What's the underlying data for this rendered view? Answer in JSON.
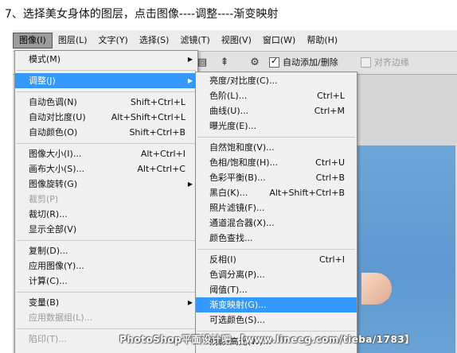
{
  "caption": "7、选择美女身体的图层，点击图像----调整----渐变映射",
  "menubar": [
    "图像(I)",
    "图层(L)",
    "文字(Y)",
    "选择(S)",
    "滤镜(T)",
    "视图(V)",
    "窗口(W)",
    "帮助(H)"
  ],
  "options_bar": {
    "auto_add_delete": "自动添加/删除",
    "align_edges": "对齐边缘"
  },
  "image_menu": [
    {
      "label": "模式(M)",
      "submenu": true
    },
    {
      "sep": true
    },
    {
      "label": "调整(J)",
      "submenu": true,
      "highlight": true
    },
    {
      "sep": true
    },
    {
      "label": "自动色调(N)",
      "shortcut": "Shift+Ctrl+L"
    },
    {
      "label": "自动对比度(U)",
      "shortcut": "Alt+Shift+Ctrl+L"
    },
    {
      "label": "自动颜色(O)",
      "shortcut": "Shift+Ctrl+B"
    },
    {
      "sep": true
    },
    {
      "label": "图像大小(I)...",
      "shortcut": "Alt+Ctrl+I"
    },
    {
      "label": "画布大小(S)...",
      "shortcut": "Alt+Ctrl+C"
    },
    {
      "label": "图像旋转(G)",
      "submenu": true
    },
    {
      "label": "裁剪(P)",
      "disabled": true
    },
    {
      "label": "裁切(R)..."
    },
    {
      "label": "显示全部(V)"
    },
    {
      "sep": true
    },
    {
      "label": "复制(D)..."
    },
    {
      "label": "应用图像(Y)..."
    },
    {
      "label": "计算(C)..."
    },
    {
      "sep": true
    },
    {
      "label": "变量(B)",
      "submenu": true
    },
    {
      "label": "应用数据组(L)...",
      "disabled": true
    },
    {
      "sep": true
    },
    {
      "label": "陷印(T)...",
      "disabled": true
    }
  ],
  "adjust_menu": [
    {
      "label": "亮度/对比度(C)..."
    },
    {
      "label": "色阶(L)...",
      "shortcut": "Ctrl+L"
    },
    {
      "label": "曲线(U)...",
      "shortcut": "Ctrl+M"
    },
    {
      "label": "曝光度(E)..."
    },
    {
      "sep": true
    },
    {
      "label": "自然饱和度(V)..."
    },
    {
      "label": "色相/饱和度(H)...",
      "shortcut": "Ctrl+U"
    },
    {
      "label": "色彩平衡(B)...",
      "shortcut": "Ctrl+B"
    },
    {
      "label": "黑白(K)...",
      "shortcut": "Alt+Shift+Ctrl+B"
    },
    {
      "label": "照片滤镜(F)..."
    },
    {
      "label": "通道混合器(X)..."
    },
    {
      "label": "颜色查找..."
    },
    {
      "sep": true
    },
    {
      "label": "反相(I)",
      "shortcut": "Ctrl+I"
    },
    {
      "label": "色调分离(P)..."
    },
    {
      "label": "阈值(T)..."
    },
    {
      "label": "渐变映射(G)...",
      "highlight": true
    },
    {
      "label": "可选颜色(S)..."
    },
    {
      "sep": true
    },
    {
      "label": "阴影/高光(W)..."
    }
  ],
  "watermark": "PhotoShop平面设计吧 【www.lineeg.com/tieba/1783】",
  "colors": {
    "highlight": "#3399ff",
    "canvas": "#6aa3d6"
  }
}
